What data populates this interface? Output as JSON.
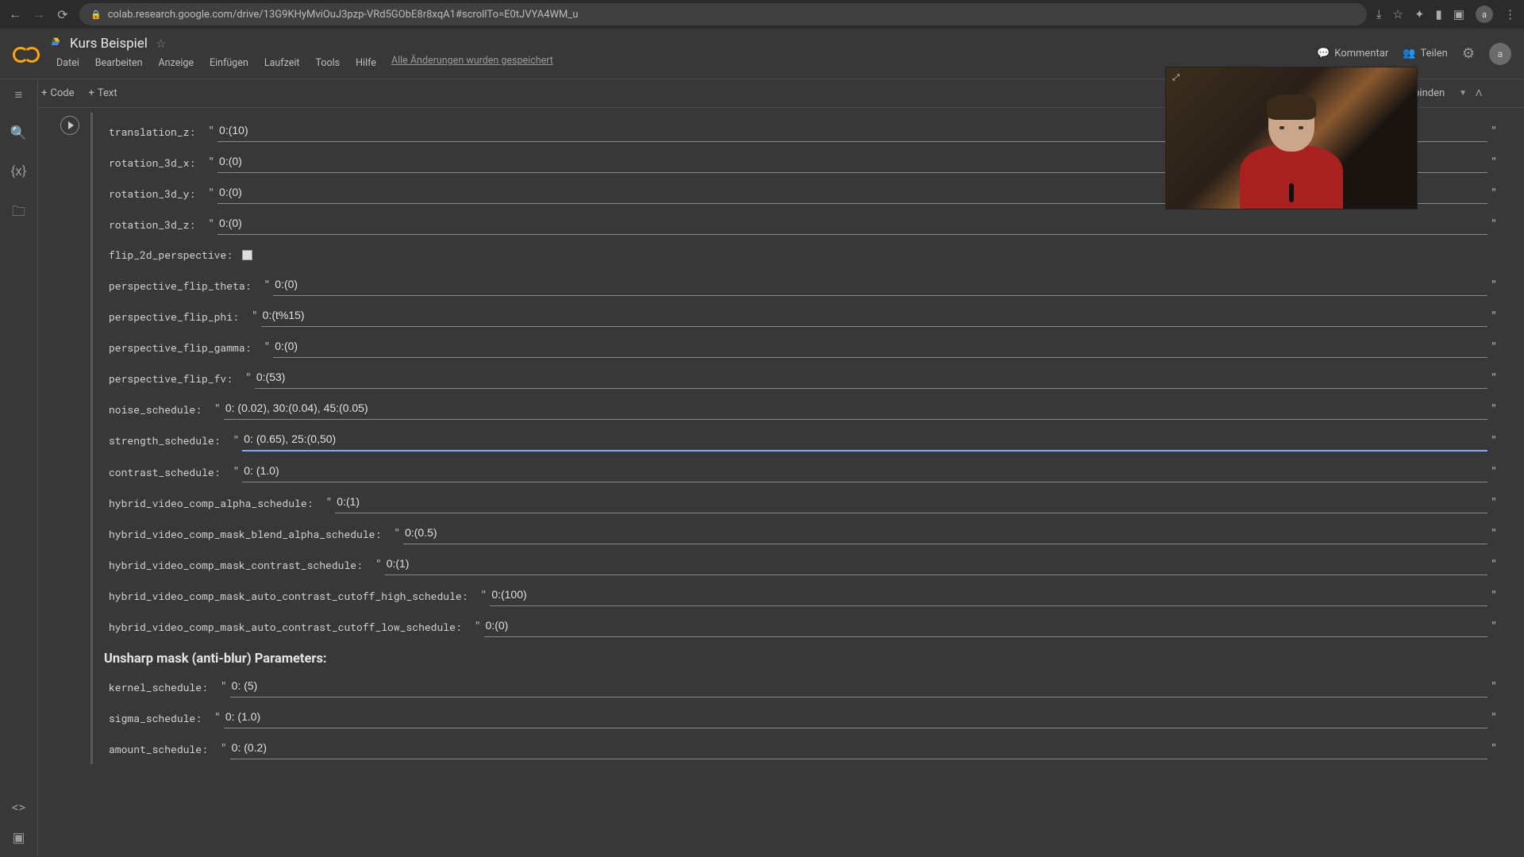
{
  "browser": {
    "url": "colab.research.google.com/drive/13G9KHyMviOuJ3pzp-VRd5GObE8r8xqA1#scrollTo=E0tJVYA4WM_u"
  },
  "header": {
    "title": "Kurs Beispiel",
    "save_status": "Alle Änderungen wurden gespeichert",
    "kommentar": "Kommentar",
    "teilen": "Teilen"
  },
  "menu": [
    "Datei",
    "Bearbeiten",
    "Anzeige",
    "Einfügen",
    "Laufzeit",
    "Tools",
    "Hilfe"
  ],
  "toolbar": {
    "code": "Code",
    "text": "Text",
    "connect": "Verbinden"
  },
  "form": {
    "translation_z": {
      "label": "translation_z:",
      "value": "0:(10)"
    },
    "rotation_3d_x": {
      "label": "rotation_3d_x:",
      "value": "0:(0)"
    },
    "rotation_3d_y": {
      "label": "rotation_3d_y:",
      "value": "0:(0)"
    },
    "rotation_3d_z": {
      "label": "rotation_3d_z:",
      "value": "0:(0)"
    },
    "flip_2d_perspective": {
      "label": "flip_2d_perspective:",
      "checked": false
    },
    "perspective_flip_theta": {
      "label": "perspective_flip_theta:",
      "value": "0:(0)"
    },
    "perspective_flip_phi": {
      "label": "perspective_flip_phi:",
      "value": "0:(t%15)"
    },
    "perspective_flip_gamma": {
      "label": "perspective_flip_gamma:",
      "value": "0:(0)"
    },
    "perspective_flip_fv": {
      "label": "perspective_flip_fv:",
      "value": "0:(53)"
    },
    "noise_schedule": {
      "label": "noise_schedule:",
      "value": "0: (0.02), 30:(0.04), 45:(0.05)"
    },
    "strength_schedule": {
      "label": "strength_schedule:",
      "value": "0: (0.65), 25:(0,50) "
    },
    "contrast_schedule": {
      "label": "contrast_schedule:",
      "value": "0: (1.0)"
    },
    "hybrid_video_comp_alpha_schedule": {
      "label": "hybrid_video_comp_alpha_schedule:",
      "value": "0:(1)"
    },
    "hybrid_video_comp_mask_blend_alpha_schedule": {
      "label": "hybrid_video_comp_mask_blend_alpha_schedule:",
      "value": "0:(0.5)"
    },
    "hybrid_video_comp_mask_contrast_schedule": {
      "label": "hybrid_video_comp_mask_contrast_schedule:",
      "value": "0:(1)"
    },
    "hybrid_video_comp_mask_auto_contrast_cutoff_high_schedule": {
      "label": "hybrid_video_comp_mask_auto_contrast_cutoff_high_schedule:",
      "value": "0:(100)"
    },
    "hybrid_video_comp_mask_auto_contrast_cutoff_low_schedule": {
      "label": "hybrid_video_comp_mask_auto_contrast_cutoff_low_schedule:",
      "value": "0:(0)"
    },
    "section_unsharp": "Unsharp mask (anti-blur) Parameters:",
    "kernel_schedule": {
      "label": "kernel_schedule:",
      "value": "0: (5)"
    },
    "sigma_schedule": {
      "label": "sigma_schedule:",
      "value": "0: (1.0)"
    },
    "amount_schedule": {
      "label": "amount_schedule:",
      "value": "0: (0.2)"
    }
  }
}
